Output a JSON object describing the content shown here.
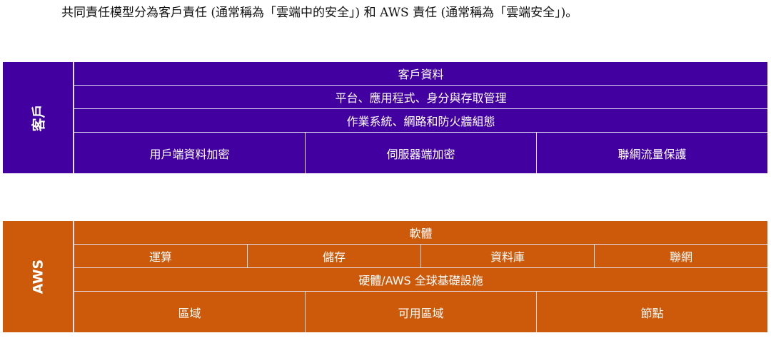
{
  "caption": "共同責任模型分為客戶責任 (通常稱為「雲端中的安全」) 和 AWS 責任 (通常稱為「雲端安全」)。",
  "colors": {
    "customer": "#4200a0",
    "aws": "#cc5a0a"
  },
  "customer": {
    "label": "客戶",
    "rows": [
      [
        "客戶資料"
      ],
      [
        "平台、應用程式、身分與存取管理"
      ],
      [
        "作業系統、網路和防火牆組態"
      ],
      [
        "用戶端資料加密",
        "伺服器端加密",
        "聯網流量保護"
      ]
    ]
  },
  "aws": {
    "label": "AWS",
    "rows": [
      [
        "軟體"
      ],
      [
        "運算",
        "儲存",
        "資料庫",
        "聯網"
      ],
      [
        "硬體/AWS 全球基礎設施"
      ],
      [
        "區域",
        "可用區域",
        "節點"
      ]
    ]
  }
}
